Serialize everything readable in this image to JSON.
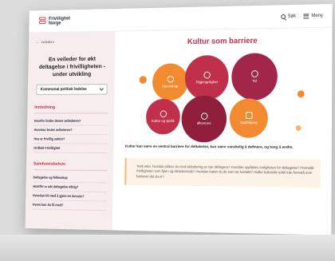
{
  "header": {
    "logo_line1": "Frivillighet",
    "logo_line2": "Norge",
    "search_label": "Søk",
    "menu_label": "Meny"
  },
  "sidebar": {
    "back_label": "Veiledere",
    "title": "En veileder for økt deltagelse i frivilligheten - under utvikling",
    "select_value": "Kommunal politisk ledelse",
    "sections": [
      {
        "title": "Innledning",
        "items": [
          "Hvorfor bruke denne veilederen?",
          "Hvordan bruke veilederen?",
          "Hva er frivillig sektor?",
          "Ordbok Frivillighet"
        ]
      },
      {
        "title": "Samfunnsbehov",
        "items": [
          "Deltagelse og fellesskap",
          "Hvorfor er økt deltagelse viktig?",
          "Hvordan bli med å gjøre en innsats?",
          "Hvem kan du få med?"
        ]
      }
    ]
  },
  "main": {
    "title": "Kultur som barriere",
    "bubbles": [
      {
        "label": "Kjennskap",
        "icon": "chat-icon"
      },
      {
        "label": "Tilgjengelighet",
        "icon": "wheelchair-icon"
      },
      {
        "label": "Tid",
        "icon": "clock-icon"
      },
      {
        "label": "Kultur og språk",
        "icon": "globe-icon"
      },
      {
        "label": "Økonomi",
        "icon": "coin-icon"
      },
      {
        "label": "Oppfølging",
        "icon": "handshake-icon"
      }
    ],
    "lead": "Kultur kan være en sentral barriere for deltakelse, kan være vanskelig å definere, og tung å endre.",
    "quote": "Tenk etter, hvordan jobber du med inkludering av nye deltagere? Hvordan oppfattes muligheten for deltagelse? Fremstår frivilligheten som åpen og inkluderende? Hvordan møter du de som tar kontakt? Hvilke kulturelle trekk kan fremstå som barrierer det du er?"
  },
  "colors": {
    "accent": "#c0304a",
    "bubble_orange": "#f28a2f",
    "bubble_red": "#c0304a",
    "bubble_dark": "#8f1f3a",
    "bubble_crimson": "#a2264a",
    "sidebar_bg": "#f7ecee"
  }
}
